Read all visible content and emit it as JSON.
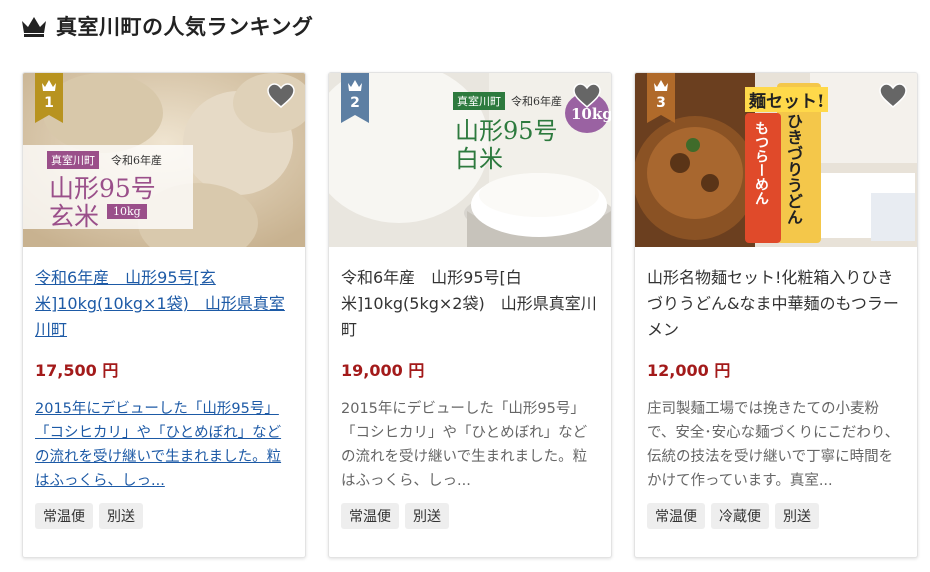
{
  "page": {
    "title": "真室川町の人気ランキング"
  },
  "items": [
    {
      "rank": "1",
      "title": "令和6年産　山形95号[玄米]10kg(10kg×1袋)　山形県真室川町",
      "price": "17,500 円",
      "description": "2015年にデビューした「山形95号」「コシヒカリ」や「ひとめぼれ」などの流れを受け継いで生まれました。粒はふっくら、しっ...",
      "tags": [
        "常温便",
        "別送"
      ],
      "ribbon_color": "#b8931f",
      "image_text": {
        "town": "真室川町",
        "year": "令和6年産",
        "brand": "山形95号",
        "type": "玄米",
        "weight": "10kg"
      }
    },
    {
      "rank": "2",
      "title": "令和6年産　山形95号[白米]10kg(5kg×2袋)　山形県真室川町",
      "price": "19,000 円",
      "description": "2015年にデビューした「山形95号」「コシヒカリ」や「ひとめぼれ」などの流れを受け継いで生まれました。粒はふっくら、しっ...",
      "tags": [
        "常温便",
        "別送"
      ],
      "ribbon_color": "#5d7fa3",
      "image_text": {
        "town": "真室川町",
        "year": "令和6年産",
        "brand": "山形95号",
        "type": "白米",
        "weight": "10kg"
      }
    },
    {
      "rank": "3",
      "title": "山形名物麺セット!化粧箱入りひきづりうどん&なま中華麺のもつラーメン",
      "price": "12,000 円",
      "description": "庄司製麺工場では挽きたての小麦粉で、安全･安心な麺づくりにこだわり、伝統の技法を受け継いで丁寧に時間をかけて作っています。真室...",
      "tags": [
        "常温便",
        "冷蔵便",
        "別送"
      ],
      "ribbon_color": "#b06a2a",
      "image_text": {
        "set": "麺セット!",
        "udon": "ひきづりうどん",
        "ramen": "もつらーめん"
      }
    }
  ]
}
